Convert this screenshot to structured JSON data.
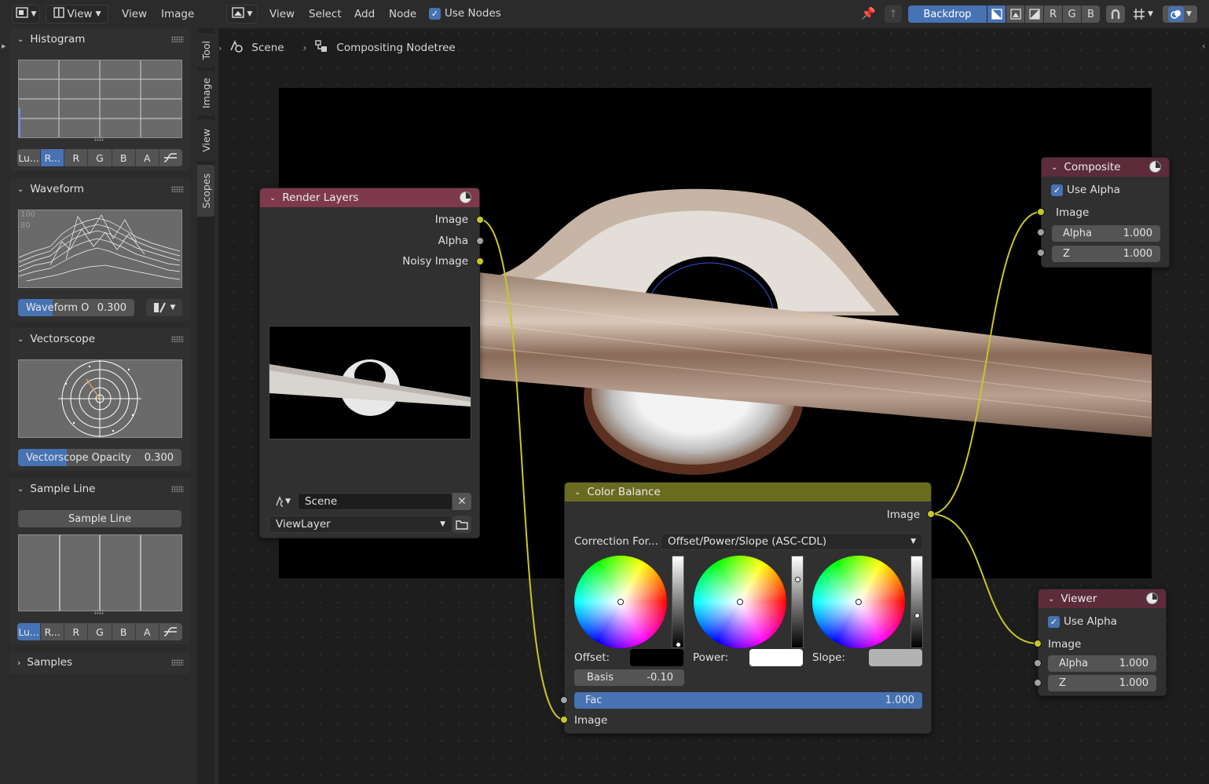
{
  "left_editor": {
    "header": {
      "view_menu": "View",
      "menu": [
        "View",
        "Image"
      ]
    },
    "tabs": [
      "Tool",
      "Image",
      "View",
      "Scopes"
    ],
    "histogram": {
      "title": "Histogram",
      "channels": [
        "Lu...",
        "R...",
        "R",
        "G",
        "B",
        "A"
      ],
      "selected": 1
    },
    "waveform": {
      "title": "Waveform",
      "opacity_label": "Waveform O",
      "opacity_value": "0.300",
      "opacity": 0.3,
      "ticks": [
        "100",
        "80"
      ]
    },
    "vectorscope": {
      "title": "Vectorscope",
      "opacity_label": "Vectorscope Opacity",
      "opacity_value": "0.300",
      "opacity": 0.3
    },
    "sample_line": {
      "title": "Sample Line",
      "button": "Sample Line",
      "channels": [
        "Lu...",
        "R...",
        "R",
        "G",
        "B",
        "A"
      ],
      "selected": 0
    },
    "samples": {
      "title": "Samples"
    }
  },
  "node_editor": {
    "header": {
      "menu": [
        "View",
        "Select",
        "Add",
        "Node"
      ],
      "use_nodes_label": "Use Nodes",
      "backdrop_label": "Backdrop",
      "channel_letters": [
        "R",
        "G",
        "B"
      ]
    },
    "breadcrumb": [
      "Scene",
      "Compositing Nodetree"
    ],
    "nodes": {
      "render_layers": {
        "title": "Render Layers",
        "outputs": [
          "Image",
          "Alpha",
          "Noisy Image"
        ],
        "scene": "Scene",
        "view_layer": "ViewLayer",
        "header_color": "#7e3a4c"
      },
      "composite": {
        "title": "Composite",
        "use_alpha_label": "Use Alpha",
        "image_label": "Image",
        "alpha_label": "Alpha",
        "alpha_value": "1.000",
        "z_label": "Z",
        "z_value": "1.000",
        "header_color": "#5c2c3b"
      },
      "viewer": {
        "title": "Viewer",
        "use_alpha_label": "Use Alpha",
        "image_label": "Image",
        "alpha_label": "Alpha",
        "alpha_value": "1.000",
        "z_label": "Z",
        "z_value": "1.000",
        "header_color": "#5c2c3b"
      },
      "color_balance": {
        "title": "Color Balance",
        "output_label": "Image",
        "correction_label": "Correction For...",
        "correction_value": "Offset/Power/Slope (ASC-CDL)",
        "offset_label": "Offset:",
        "power_label": "Power:",
        "slope_label": "Slope:",
        "offset_color": "#000000",
        "power_color": "#ffffff",
        "slope_color": "#b3b3b3",
        "basis_label": "Basis",
        "basis_value": "-0.10",
        "fac_label": "Fac",
        "fac_value": "1.000",
        "input_label": "Image",
        "header_color": "#6b6b20"
      }
    }
  }
}
